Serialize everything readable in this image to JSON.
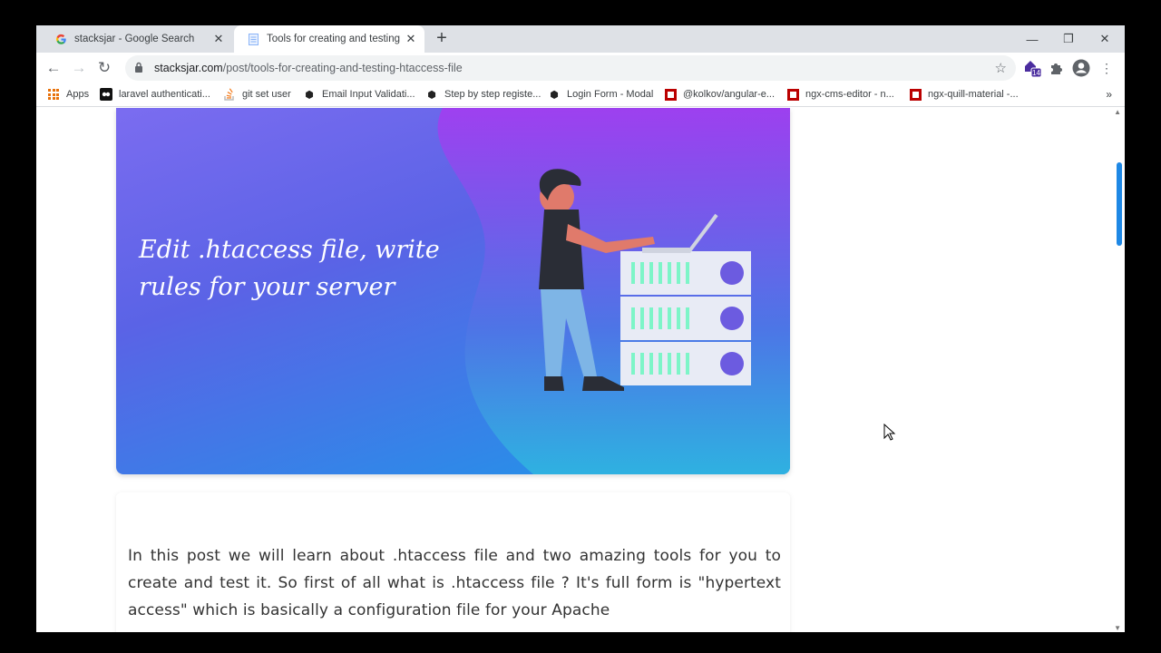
{
  "tabs": [
    {
      "title": "stacksjar - Google Search",
      "icon": "google-g-icon"
    },
    {
      "title": "Tools for creating and testing .ht",
      "icon": "document-icon"
    }
  ],
  "window": {
    "minimize": "—",
    "restore": "❐",
    "close": "✕"
  },
  "toolbar": {
    "url_host": "stacksjar.com",
    "url_path": "/post/tools-for-creating-and-testing-htaccess-file",
    "extension_badge": "14"
  },
  "bookmarks": [
    {
      "label": "Apps",
      "icon": "apps-grid-icon"
    },
    {
      "label": "laravel authenticati...",
      "icon": "laracasts-icon"
    },
    {
      "label": "git set user",
      "icon": "stackoverflow-icon"
    },
    {
      "label": "Email Input Validati...",
      "icon": "codepen-icon"
    },
    {
      "label": "Step by step registe...",
      "icon": "codepen-icon"
    },
    {
      "label": "Login Form - Modal",
      "icon": "codepen-icon"
    },
    {
      "label": "@kolkov/angular-e...",
      "icon": "npm-icon"
    },
    {
      "label": "ngx-cms-editor - n...",
      "icon": "npm-icon"
    },
    {
      "label": "ngx-quill-material -...",
      "icon": "npm-icon"
    }
  ],
  "hero": {
    "title": "Edit .htaccess file, write rules for your server",
    "colors": {
      "top_left": "#7b6cf0",
      "top": "#9b3df0",
      "bottom": "#2b8ce8"
    }
  },
  "post": {
    "body": "In this post we will learn about .htaccess file and two amazing tools for you to create and test it. So first of all what is .htaccess file ? It's full form is \"hypertext access\" which is basically a configuration file for your Apache"
  }
}
